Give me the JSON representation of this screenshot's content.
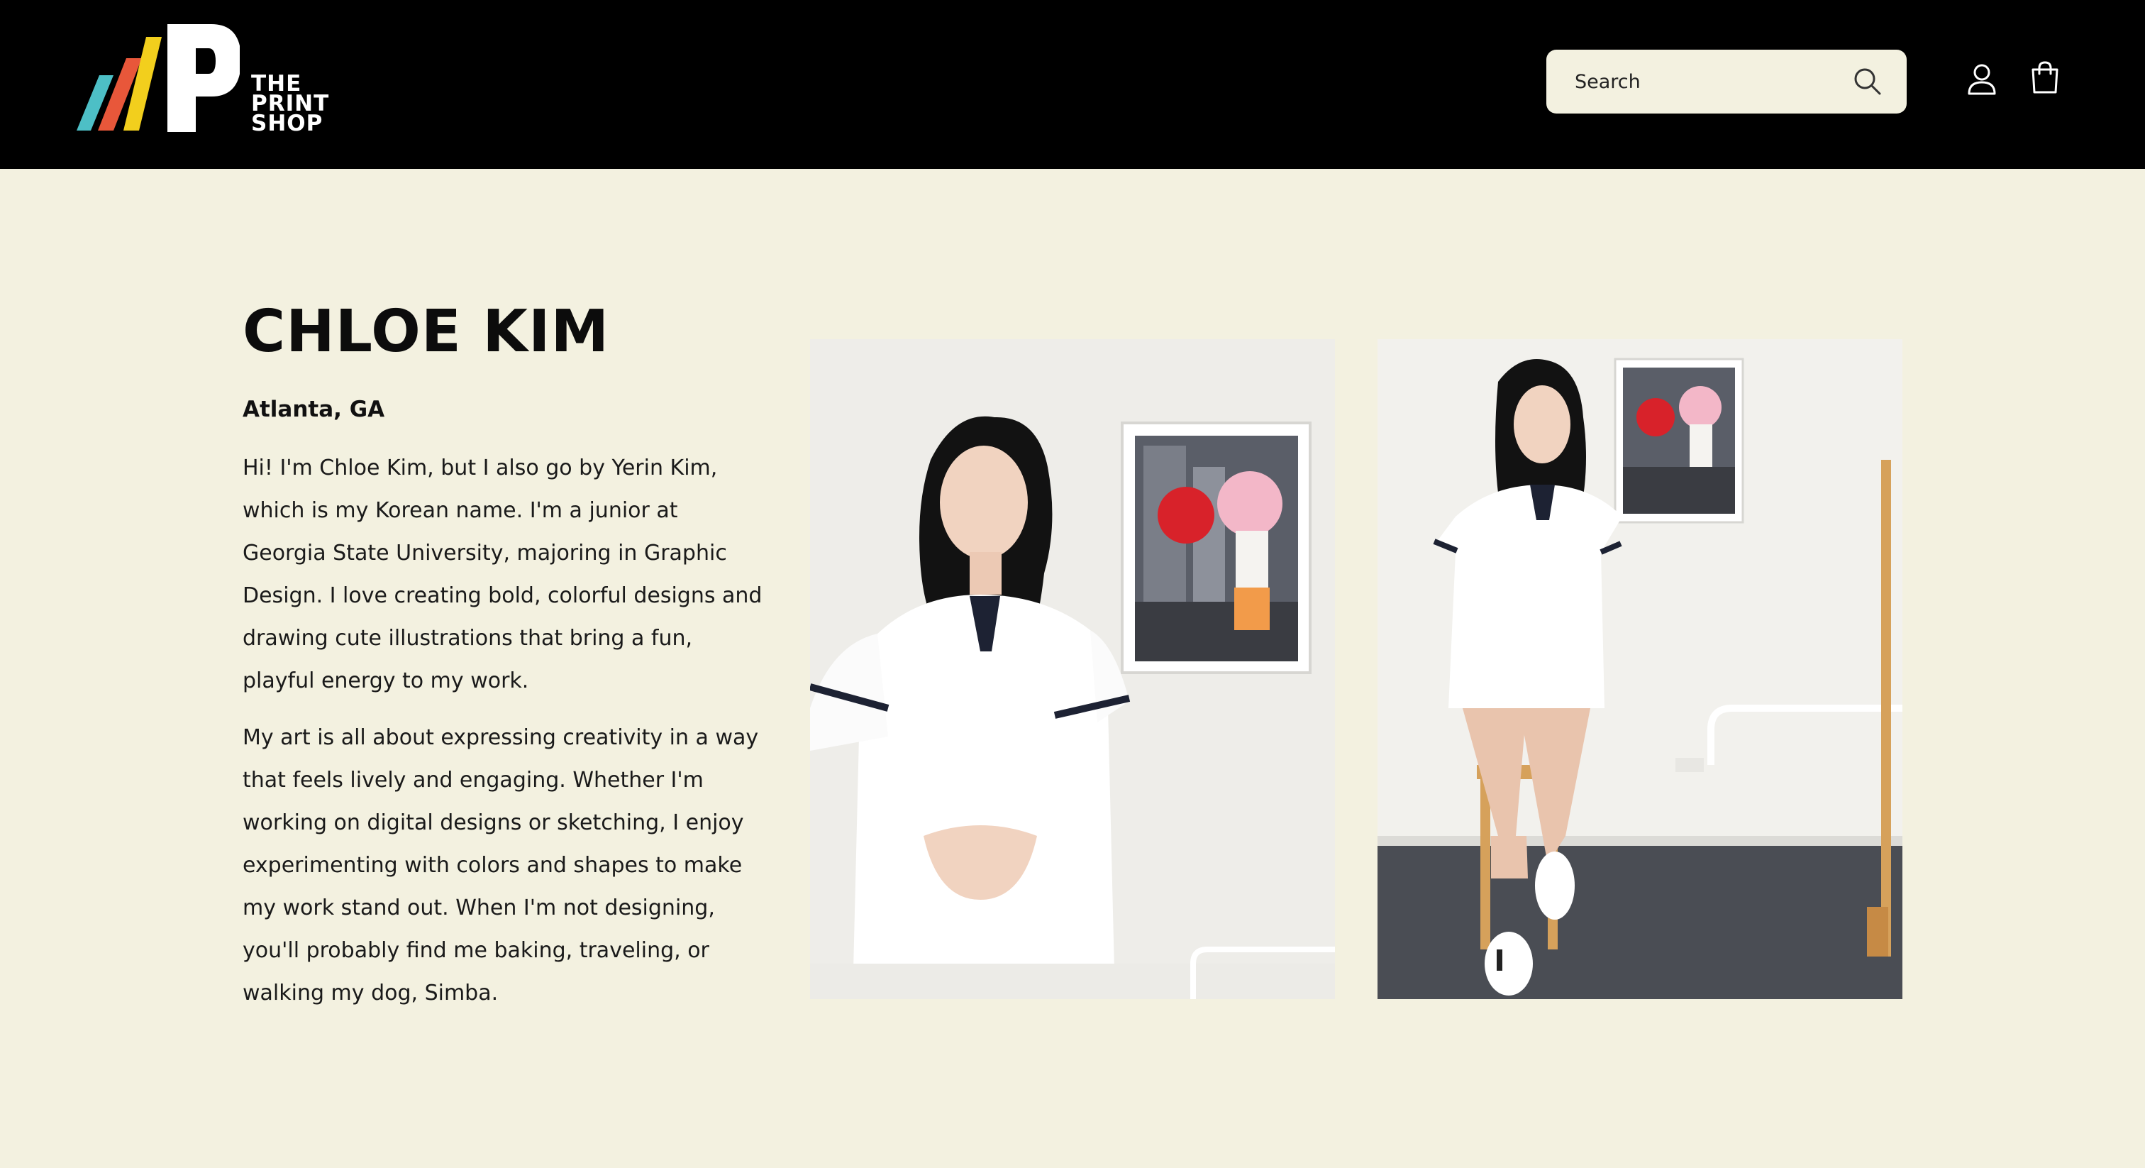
{
  "brand": {
    "logo_line1": "THE",
    "logo_line2": "PRINT",
    "logo_line3": "SHOP",
    "colors": {
      "header_bg": "#000000",
      "page_bg": "#f3f1e0",
      "stripe_teal": "#4dbfc6",
      "stripe_orange": "#e8573a",
      "stripe_yellow": "#f2cf1d"
    }
  },
  "header": {
    "search": {
      "placeholder": "Search",
      "icon": "search-icon"
    },
    "account_icon": "account-icon",
    "cart_icon": "cart-icon"
  },
  "artist": {
    "name": "CHLOE KIM",
    "location": "Atlanta, GA",
    "bio_paragraphs": [
      "Hi! I'm Chloe Kim, but I also go by Yerin Kim, which is my Korean name. I'm a junior at Georgia State University, majoring in Graphic Design. I love creating bold, colorful designs and drawing cute illustrations that bring a fun, playful energy to my work.",
      "My art is all about expressing creativity in a way that feels lively and engaging. Whether I'm working on digital designs or sketching, I enjoy experimenting with colors and shapes to make my work stand out. When I'm not designing, you'll probably find me baking, traveling, or walking my dog, Simba."
    ]
  }
}
